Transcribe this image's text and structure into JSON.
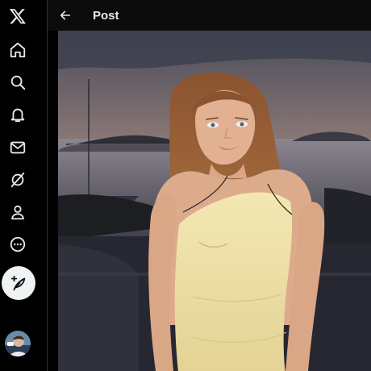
{
  "app": {
    "logo_icon": "x-logo-icon"
  },
  "sidebar": {
    "items": [
      {
        "name": "home",
        "icon": "home-icon"
      },
      {
        "name": "explore",
        "icon": "search-icon"
      },
      {
        "name": "notifications",
        "icon": "bell-icon"
      },
      {
        "name": "messages",
        "icon": "envelope-icon"
      },
      {
        "name": "grok",
        "icon": "grok-icon"
      },
      {
        "name": "profile",
        "icon": "person-icon"
      },
      {
        "name": "more",
        "icon": "more-circle-icon"
      }
    ],
    "compose_icon": "compose-feather-icon"
  },
  "header": {
    "back_icon": "arrow-left-icon",
    "title": "Post"
  },
  "colors": {
    "background": "#000000",
    "text": "#e7e9ea",
    "compose_bg": "#eff3f4",
    "divider": "#2f3336"
  }
}
